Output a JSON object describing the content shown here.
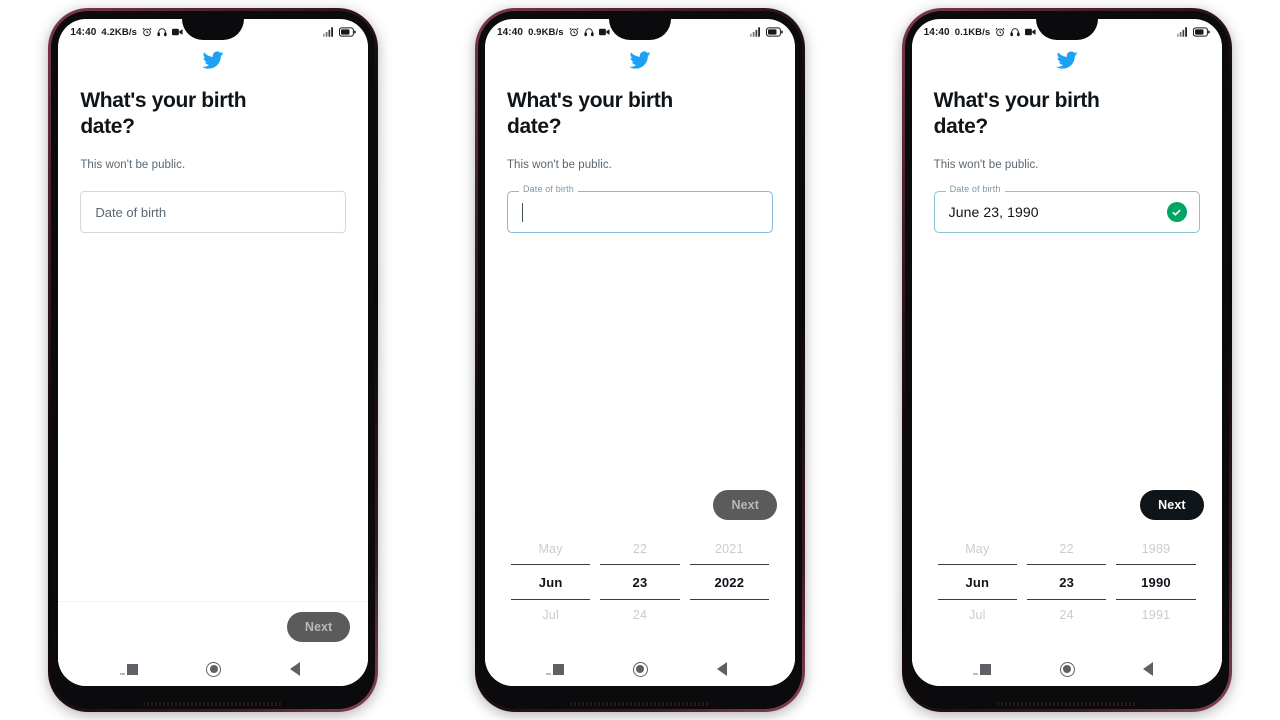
{
  "app": {
    "logo_icon": "twitter-bird-icon",
    "brand_color": "#1da1f2",
    "headline": "What's your birth date?",
    "subtext": "This won't be public."
  },
  "phones": [
    {
      "id": "phone-resting",
      "status_bar": {
        "time": "14:40",
        "network_speed": "4.2KB/s",
        "icons_left": [
          "alarm-icon",
          "headphones-icon",
          "video-record-icon"
        ],
        "icons_right": [
          "signal-bars-icon",
          "battery-icon"
        ]
      },
      "field": {
        "state": "resting",
        "label": "Date of birth",
        "placeholder": "Date of birth",
        "value": "",
        "has_check": false
      },
      "next_button": {
        "label": "Next",
        "state": "disabled"
      },
      "divider": true,
      "picker_visible": false,
      "nav_bar": {
        "recents_icon": "recents-square-icon",
        "home_icon": "home-circle-icon",
        "back_icon": "back-triangle-icon"
      }
    },
    {
      "id": "phone-focused",
      "status_bar": {
        "time": "14:40",
        "network_speed": "0.9KB/s",
        "icons_left": [
          "alarm-icon",
          "headphones-icon",
          "video-record-icon"
        ],
        "icons_right": [
          "signal-bars-icon",
          "battery-icon"
        ]
      },
      "field": {
        "state": "focused",
        "label": "Date of birth",
        "placeholder": "",
        "value": "",
        "has_check": false
      },
      "next_button": {
        "label": "Next",
        "state": "disabled"
      },
      "divider": false,
      "picker_visible": true,
      "picker": {
        "columns": [
          {
            "name": "month",
            "above": "May",
            "selected": "Jun",
            "below": "Jul"
          },
          {
            "name": "day",
            "above": "22",
            "selected": "23",
            "below": "24"
          },
          {
            "name": "year",
            "above": "2021",
            "selected": "2022",
            "below": ""
          }
        ]
      },
      "nav_bar": {
        "recents_icon": "recents-square-icon",
        "home_icon": "home-circle-icon",
        "back_icon": "back-triangle-icon"
      }
    },
    {
      "id": "phone-filled",
      "status_bar": {
        "time": "14:40",
        "network_speed": "0.1KB/s",
        "icons_left": [
          "alarm-icon",
          "headphones-icon",
          "video-record-icon"
        ],
        "icons_right": [
          "signal-bars-icon",
          "battery-icon"
        ]
      },
      "field": {
        "state": "filled",
        "label": "Date of birth",
        "placeholder": "",
        "value": "June 23, 1990",
        "has_check": true,
        "check_icon": "check-circle-icon",
        "check_color": "#00a563"
      },
      "next_button": {
        "label": "Next",
        "state": "enabled"
      },
      "divider": false,
      "picker_visible": true,
      "picker": {
        "columns": [
          {
            "name": "month",
            "above": "May",
            "selected": "Jun",
            "below": "Jul"
          },
          {
            "name": "day",
            "above": "22",
            "selected": "23",
            "below": "24"
          },
          {
            "name": "year",
            "above": "1989",
            "selected": "1990",
            "below": "1991"
          }
        ]
      },
      "nav_bar": {
        "recents_icon": "recents-square-icon",
        "home_icon": "home-circle-icon",
        "back_icon": "back-triangle-icon"
      }
    }
  ]
}
